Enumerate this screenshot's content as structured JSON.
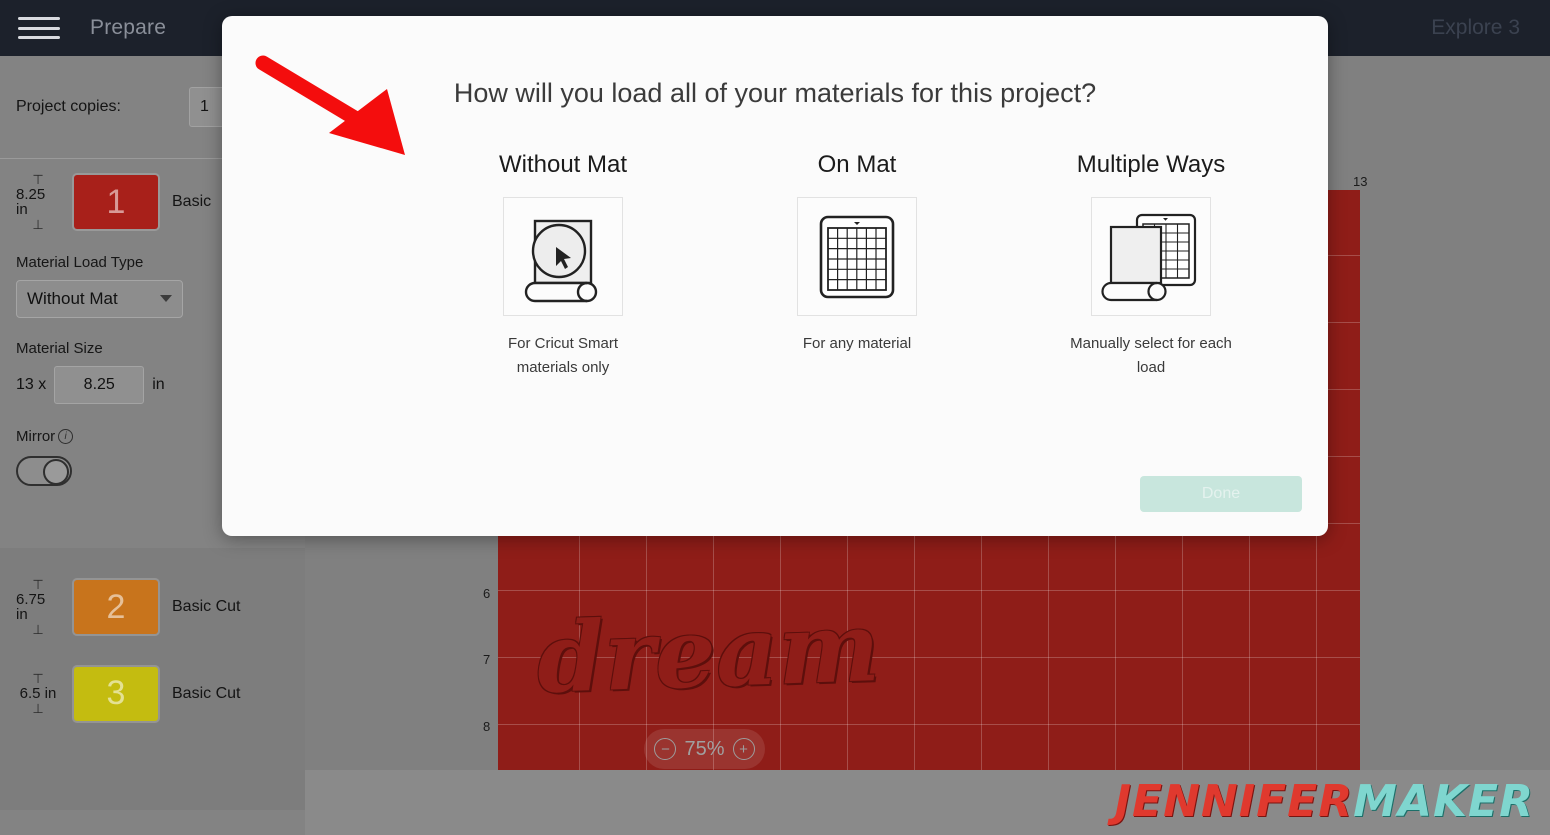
{
  "topnav": {
    "menu_icon": "hamburger-icon",
    "title": "Prepare",
    "machine": "Explore 3"
  },
  "left_panel": {
    "copies_label": "Project copies:",
    "copies_value": "1",
    "active_mat": {
      "height": "8.25 in",
      "number": "1",
      "cut_label": "Basic",
      "swatch_color": "#a8201a"
    },
    "load_type": {
      "label": "Material Load Type",
      "value": "Without Mat"
    },
    "material_size": {
      "label": "Material Size",
      "width": "13 x",
      "height_value": "8.25",
      "unit": "in"
    },
    "mirror": {
      "label": "Mirror",
      "info_icon": "info-icon",
      "enabled": false
    },
    "mats": [
      {
        "height": "6.75 in",
        "number": "2",
        "cut_label": "Basic Cut",
        "swatch_color": "#c8741c"
      },
      {
        "height": "6.5 in",
        "number": "3",
        "cut_label": "Basic Cut",
        "swatch_color": "#c4bc10"
      }
    ]
  },
  "canvas": {
    "ruler_top": "13",
    "ruler_side": [
      "6",
      "7",
      "8"
    ],
    "design_word": "dream",
    "zoom": {
      "minus_icon": "minus-icon",
      "level": "75%",
      "plus_icon": "plus-icon"
    },
    "watermark": {
      "part1": "JENNIFER",
      "part2": "MAKER"
    }
  },
  "modal": {
    "title": "How will you load all of your materials for this project?",
    "options": [
      {
        "title": "Without Mat",
        "icon": "rolled-material-icon",
        "caption": "For Cricut Smart materials only"
      },
      {
        "title": "On Mat",
        "icon": "cutting-mat-icon",
        "caption": "For any material"
      },
      {
        "title": "Multiple Ways",
        "icon": "material-and-mat-icon",
        "caption": "Manually select for each load"
      }
    ],
    "done_label": "Done"
  },
  "annotation": {
    "arrow_icon": "red-arrow-icon",
    "color": "#f40d0d"
  }
}
